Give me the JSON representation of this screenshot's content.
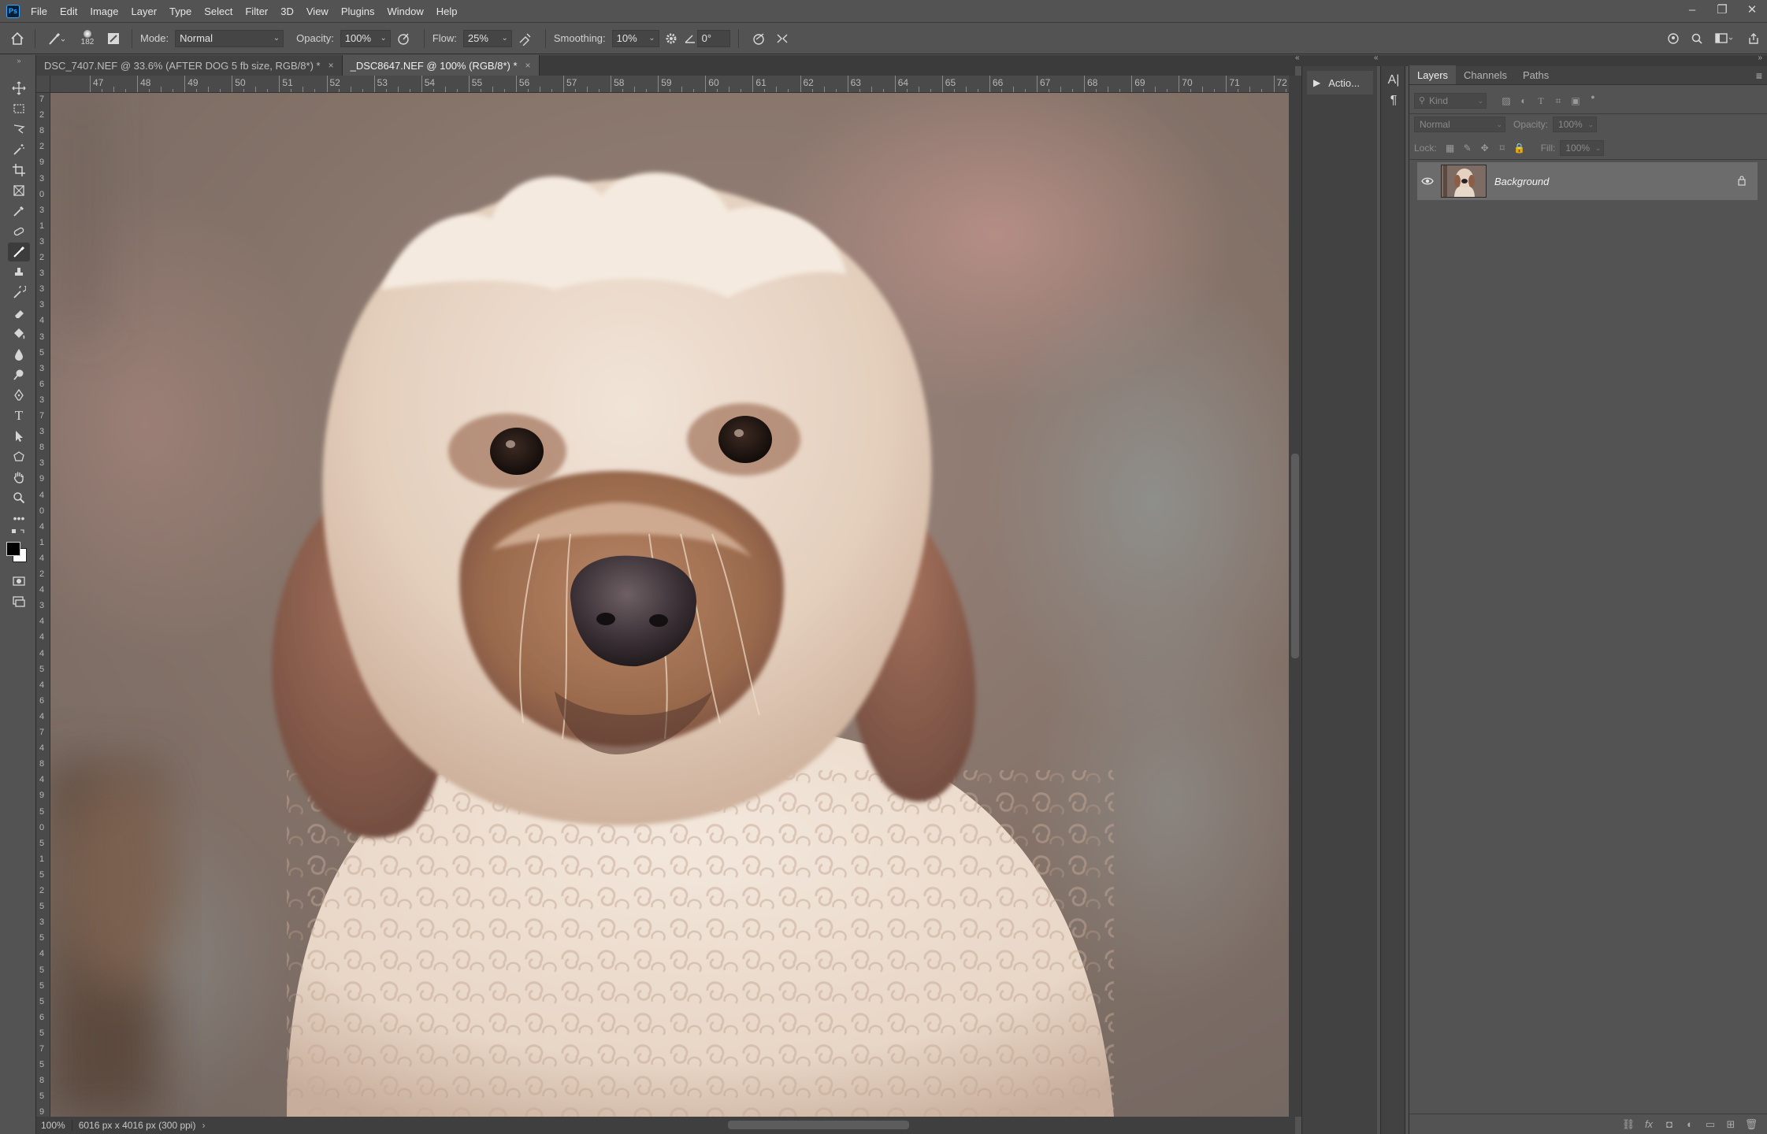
{
  "app": {
    "logo_text": "Ps",
    "menu": [
      "File",
      "Edit",
      "Image",
      "Layer",
      "Type",
      "Select",
      "Filter",
      "3D",
      "View",
      "Plugins",
      "Window",
      "Help"
    ],
    "window_controls": [
      "–",
      "❐",
      "✕"
    ]
  },
  "options": {
    "brush_size": "182",
    "mode_label": "Mode:",
    "mode_value": "Normal",
    "opacity_label": "Opacity:",
    "opacity_value": "100%",
    "flow_label": "Flow:",
    "flow_value": "25%",
    "smoothing_label": "Smoothing:",
    "smoothing_value": "10%",
    "angle_value": "0°"
  },
  "documents": {
    "tabs": [
      {
        "label": "DSC_7407.NEF @ 33.6% (AFTER DOG 5 fb size, RGB/8*) *",
        "active": false
      },
      {
        "label": "_DSC8647.NEF @ 100% (RGB/8*) *",
        "active": true
      }
    ],
    "close_glyph": "×"
  },
  "rulers": {
    "top_labels": [
      "47",
      "48",
      "49",
      "50",
      "51",
      "52",
      "53",
      "54",
      "55",
      "56",
      "57",
      "58",
      "59",
      "60",
      "61",
      "62",
      "63",
      "64",
      "65",
      "66",
      "67",
      "68",
      "69",
      "70",
      "71",
      "72"
    ],
    "left_labels": [
      "7",
      "2",
      "8",
      "2",
      "9",
      "3",
      "0",
      "3",
      "1",
      "3",
      "2",
      "3",
      "3",
      "3",
      "4",
      "3",
      "5",
      "3",
      "6",
      "3",
      "7",
      "3",
      "8",
      "3",
      "9",
      "4",
      "0",
      "4",
      "1",
      "4",
      "2",
      "4",
      "3",
      "4",
      "4",
      "4",
      "5",
      "4",
      "6",
      "4",
      "7",
      "4",
      "8",
      "4",
      "9",
      "5",
      "0",
      "5",
      "1",
      "5",
      "2",
      "5",
      "3",
      "5",
      "4",
      "5",
      "5",
      "5",
      "6",
      "5",
      "7",
      "5",
      "8",
      "5",
      "9"
    ]
  },
  "status": {
    "zoom": "100%",
    "doc_info": "6016 px x 4016 px (300 ppi)",
    "arrow": "›"
  },
  "panels": {
    "actions_label": "Actio...",
    "char_icons": [
      "A|",
      "¶"
    ],
    "layers_tabs": [
      "Layers",
      "Channels",
      "Paths"
    ],
    "filter_placeholder": "Kind",
    "blend_mode": "Normal",
    "opacity_label": "Opacity:",
    "opacity_value": "100%",
    "lock_label": "Lock:",
    "fill_label": "Fill:",
    "fill_value": "100%",
    "layer_name": "Background",
    "footer_icons": [
      "link-icon",
      "fx-icon",
      "mask-icon",
      "adjustment-icon",
      "group-icon",
      "new-layer-icon",
      "trash-icon"
    ],
    "footer_glyphs": [
      "⛓",
      "fx",
      "◘",
      "◐",
      "▭",
      "⊞",
      "🗑"
    ]
  },
  "colors": {
    "ui_bg": "#535353",
    "panel_dark": "#424242",
    "selected_layer": "#6c6c6c",
    "accent": "#31a8ff"
  }
}
